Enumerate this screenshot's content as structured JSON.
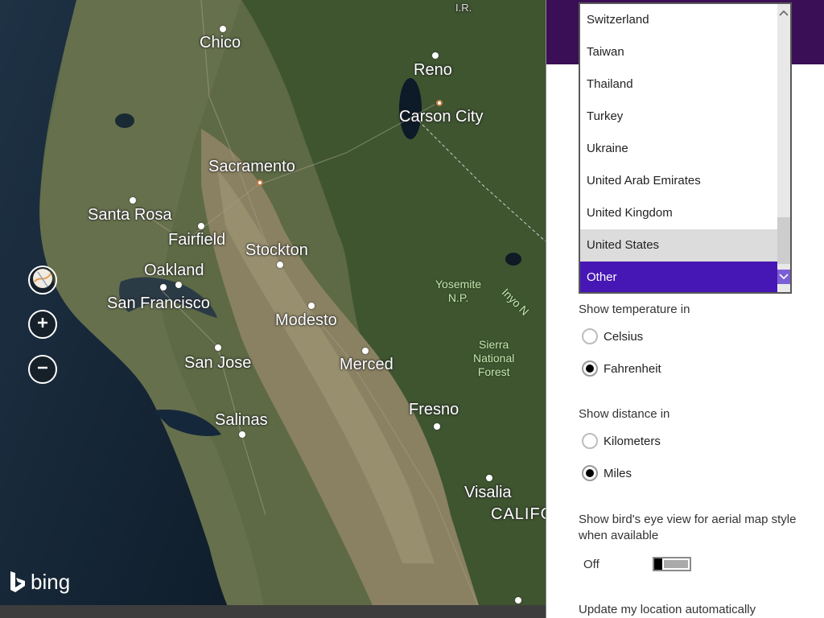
{
  "map": {
    "provider": "bing",
    "cities": [
      {
        "id": "chico",
        "name": "Chico"
      },
      {
        "id": "reno",
        "name": "Reno"
      },
      {
        "id": "carson-city",
        "name": "Carson City"
      },
      {
        "id": "sacramento",
        "name": "Sacramento"
      },
      {
        "id": "santa-rosa",
        "name": "Santa Rosa"
      },
      {
        "id": "fairfield",
        "name": "Fairfield"
      },
      {
        "id": "stockton",
        "name": "Stockton"
      },
      {
        "id": "oakland",
        "name": "Oakland"
      },
      {
        "id": "san-francisco",
        "name": "San Francisco"
      },
      {
        "id": "modesto",
        "name": "Modesto"
      },
      {
        "id": "san-jose",
        "name": "San Jose"
      },
      {
        "id": "merced",
        "name": "Merced"
      },
      {
        "id": "fresno",
        "name": "Fresno"
      },
      {
        "id": "salinas",
        "name": "Salinas"
      },
      {
        "id": "visalia",
        "name": "Visalia"
      },
      {
        "id": "california",
        "name": "CALIFO"
      },
      {
        "id": "ir",
        "name": "I.R."
      }
    ],
    "parks": {
      "yosemite": "Yosemite\nN.P.",
      "sierra": "Sierra\nNational\nForest",
      "inyo": "Inyo N"
    },
    "controls": {
      "map_style_icon": "map-style-icon",
      "zoom_in_icon": "plus-icon",
      "zoom_out_icon": "minus-icon"
    }
  },
  "settings": {
    "header_color": "#3b0f55",
    "temperature": {
      "label": "Show temperature in",
      "options": [
        "Celsius",
        "Fahrenheit"
      ],
      "selected": "Fahrenheit"
    },
    "distance": {
      "label": "Show distance in",
      "options": [
        "Kilometers",
        "Miles"
      ],
      "selected": "Miles"
    },
    "birds_eye": {
      "label": "Show bird's eye view for aerial map style when available",
      "toggle_state": "Off"
    },
    "update_location": {
      "label": "Update my location automatically"
    }
  },
  "dropdown": {
    "items": [
      "Switzerland",
      "Taiwan",
      "Thailand",
      "Turkey",
      "Ukraine",
      "United Arab Emirates",
      "United Kingdom",
      "United States",
      "Other"
    ],
    "hovered": "United States",
    "selected": "Other",
    "accent_color": "#4617b4"
  }
}
